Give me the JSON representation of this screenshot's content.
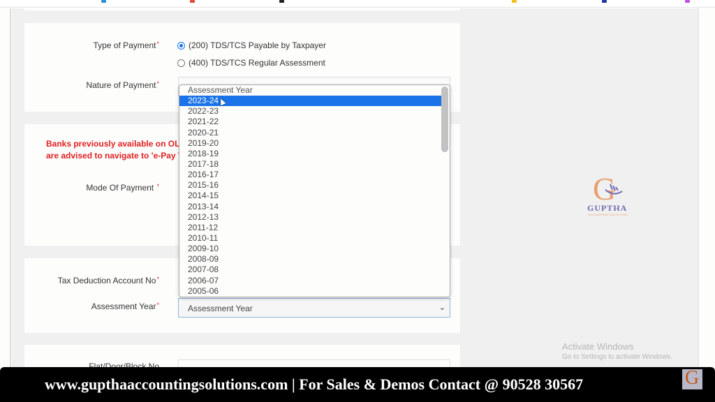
{
  "form": {
    "type_of_payment": {
      "label": "Type of Payment",
      "required_mark": "*",
      "options": [
        {
          "label": "(200) TDS/TCS Payable by Taxpayer",
          "checked": true
        },
        {
          "label": "(400) TDS/TCS Regular Assessment",
          "checked": false
        }
      ]
    },
    "nature_of_payment": {
      "label": "Nature of Payment",
      "required_mark": "*"
    },
    "bank_notice": {
      "line1": "Banks previously available on OLT",
      "line2": "are advised to navigate to 'e-Pay T"
    },
    "mode_of_payment": {
      "label": "Mode Of Payment",
      "required_mark": "*"
    },
    "tan": {
      "label": "Tax Deduction Account No",
      "required_mark": "*"
    },
    "assessment_year": {
      "label": "Assessment Year",
      "required_mark": "*",
      "value": "Assessment Year",
      "chevron": "⌄"
    },
    "flat": {
      "label": "Flat/Door/Block No"
    }
  },
  "dropdown": {
    "options": [
      {
        "label": "Assessment Year",
        "state": "placeholder"
      },
      {
        "label": "2023-24",
        "state": "selected"
      },
      {
        "label": "2022-23",
        "state": ""
      },
      {
        "label": "2021-22",
        "state": ""
      },
      {
        "label": "2020-21",
        "state": ""
      },
      {
        "label": "2019-20",
        "state": ""
      },
      {
        "label": "2018-19",
        "state": ""
      },
      {
        "label": "2017-18",
        "state": ""
      },
      {
        "label": "2016-17",
        "state": ""
      },
      {
        "label": "2015-16",
        "state": ""
      },
      {
        "label": "2014-15",
        "state": ""
      },
      {
        "label": "2013-14",
        "state": ""
      },
      {
        "label": "2012-13",
        "state": ""
      },
      {
        "label": "2011-12",
        "state": ""
      },
      {
        "label": "2010-11",
        "state": ""
      },
      {
        "label": "2009-10",
        "state": ""
      },
      {
        "label": "2008-09",
        "state": ""
      },
      {
        "label": "2007-08",
        "state": ""
      },
      {
        "label": "2006-07",
        "state": ""
      },
      {
        "label": "2005-06",
        "state": ""
      }
    ]
  },
  "watermark_logo": {
    "letter": "G",
    "name": "GUPTHA",
    "subtitle": "ACCOUNTING SOLUTIONS"
  },
  "activate_windows": {
    "title": "Activate Windows",
    "subtitle": "Go to Settings to activate Windows."
  },
  "banner": {
    "text": "www.gupthaaccountingsolutions.com | For Sales & Demos Contact @ 90528 30567",
    "logo_letter": "G"
  },
  "colors": {
    "accent": "#1a73e8",
    "warning": "#e02020",
    "logo_orange": "#e8a070",
    "logo_purple": "#6e6ab5"
  }
}
